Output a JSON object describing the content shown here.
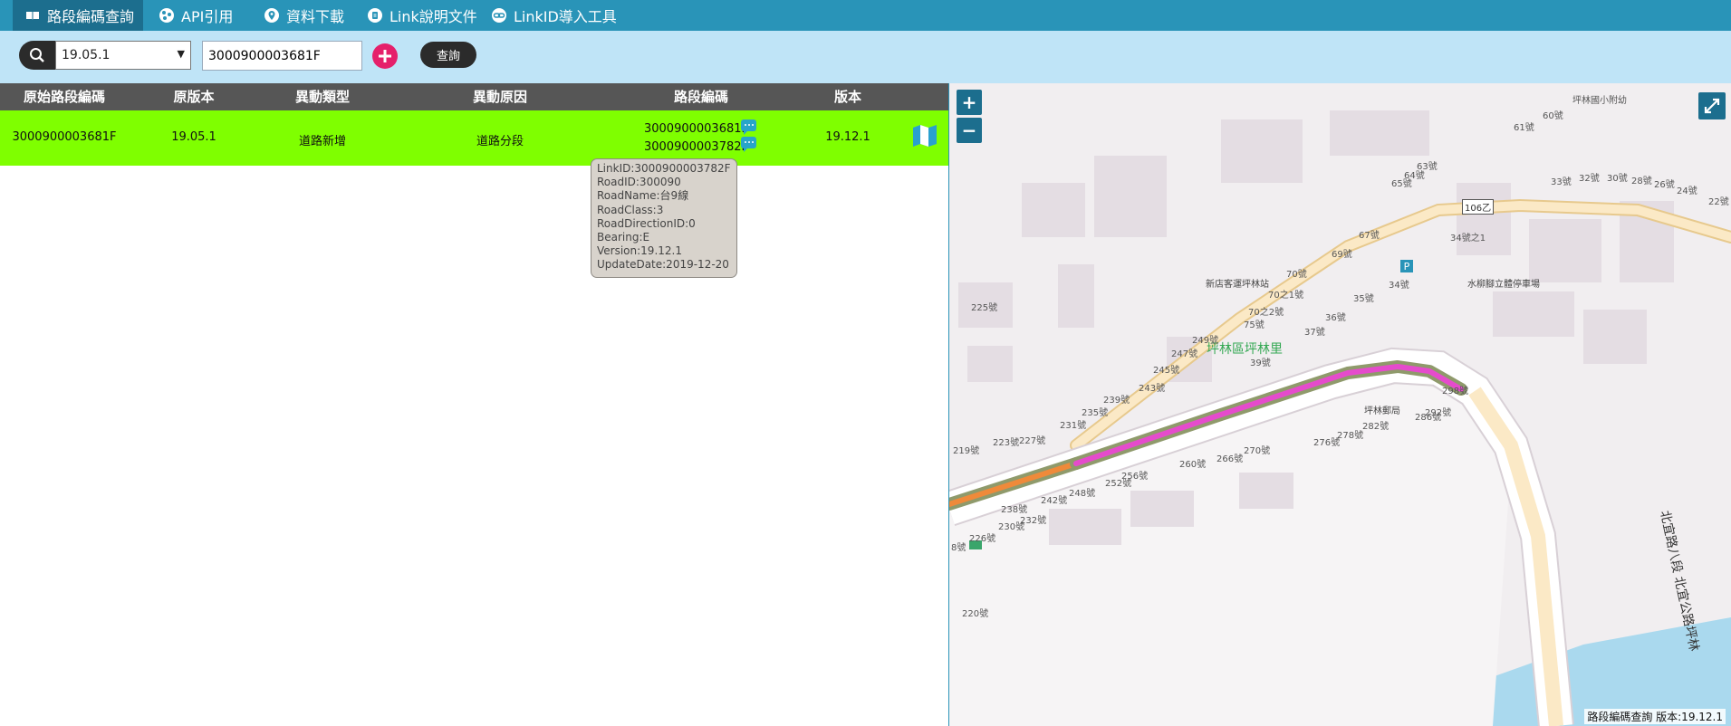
{
  "nav": {
    "tabs": [
      {
        "label": "路段編碼查詢",
        "icon": "book-icon"
      },
      {
        "label": "API引用",
        "icon": "network-icon"
      },
      {
        "label": "資料下載",
        "icon": "map-pin-icon"
      },
      {
        "label": "Link說明文件",
        "icon": "document-icon"
      },
      {
        "label": "LinkID導入工具",
        "icon": "link-icon"
      }
    ],
    "active_index": 0
  },
  "toolbar": {
    "version_selected": "19.05.1",
    "link_input_value": "3000900003681F",
    "query_label": "查詢"
  },
  "table": {
    "headers": [
      "原始路段編碼",
      "原版本",
      "異動類型",
      "異動原因",
      "路段編碼",
      "版本"
    ],
    "rows": [
      {
        "original_link": "3000900003681F",
        "original_version": "19.05.1",
        "change_type": "道路新增",
        "change_reason": "道路分段",
        "new_links": [
          "3000900003681F",
          "3000900003782F"
        ],
        "version": "19.12.1"
      }
    ]
  },
  "tooltip": {
    "lines": [
      "LinkID:3000900003782F",
      "RoadID:300090",
      "RoadName:台9線",
      "RoadClass:3",
      "RoadDirectionID:0",
      "Bearing:E",
      "Version:19.12.1",
      "UpdateDate:2019-12-20"
    ]
  },
  "map": {
    "zoom_in": "+",
    "zoom_out": "−",
    "labels": {
      "school": "坪林國小附幼",
      "village": "坪林區坪林里",
      "station": "新店客運坪林站",
      "parking": "水柳腳立體停車場",
      "office": "坪林郵局",
      "road": "北宜路八段 北宜公路坪林",
      "route": "106乙",
      "n34_1": "34號之1",
      "n70_1": "70之1號",
      "n70_2": "70之2號"
    },
    "numbers": [
      "60號",
      "61號",
      "63號",
      "64號",
      "65號",
      "67號",
      "69號",
      "70號",
      "75號",
      "33號",
      "32號",
      "30號",
      "28號",
      "26號",
      "24號",
      "22號",
      "34號",
      "35號",
      "36號",
      "37號",
      "39號",
      "249號",
      "247號",
      "245號",
      "243號",
      "239號",
      "235號",
      "231號",
      "227號",
      "223號",
      "219號",
      "225號",
      "298號",
      "286號",
      "292號",
      "282號",
      "278號",
      "276號",
      "270號",
      "266號",
      "260號",
      "256號",
      "252號",
      "248號",
      "242號",
      "238號",
      "232號",
      "230號",
      "226號",
      "220號",
      "8號"
    ],
    "footer": "路段編碼查詢 版本:19.12.1",
    "colors": {
      "highlight": "#e54bcc",
      "casing": "#8f9a6b",
      "orange": "#ef8a3a",
      "road": "#fbe9c6",
      "river": "#aad9ee"
    }
  }
}
